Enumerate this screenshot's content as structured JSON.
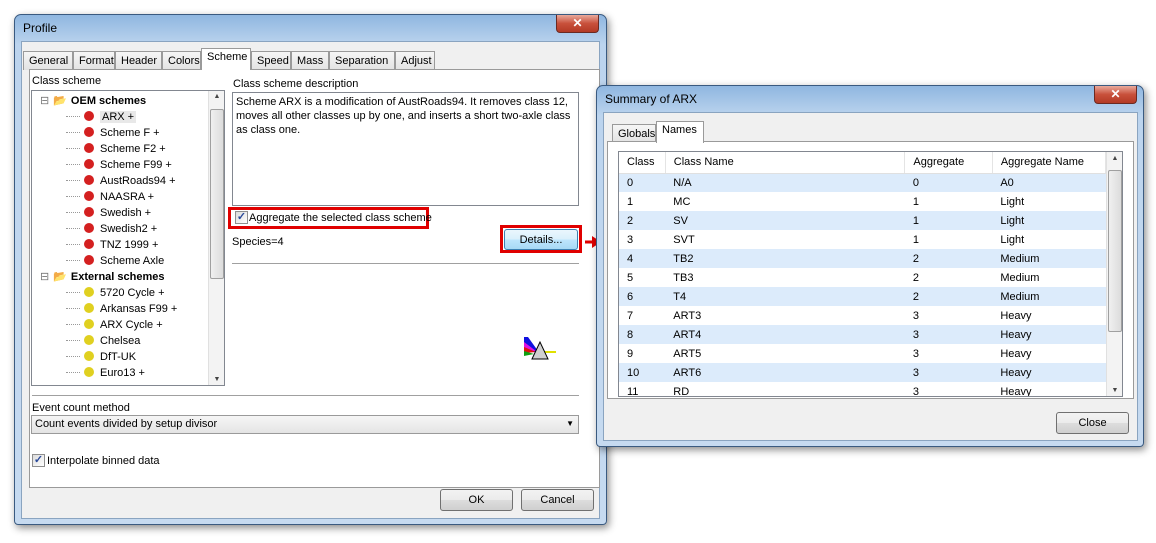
{
  "profile": {
    "title": "Profile",
    "tabs": [
      "General",
      "Format",
      "Header",
      "Colors",
      "Scheme",
      "Speed",
      "Mass",
      "Separation",
      "Adjust"
    ],
    "active_tab": "Scheme",
    "class_scheme_label": "Class scheme",
    "tree": [
      {
        "label": "OEM schemes",
        "group": true
      },
      {
        "label": "ARX +",
        "type": "oem",
        "selected": true
      },
      {
        "label": "Scheme F +",
        "type": "oem"
      },
      {
        "label": "Scheme F2 +",
        "type": "oem"
      },
      {
        "label": "Scheme F99 +",
        "type": "oem"
      },
      {
        "label": "AustRoads94 +",
        "type": "oem"
      },
      {
        "label": "NAASRA +",
        "type": "oem"
      },
      {
        "label": "Swedish +",
        "type": "oem"
      },
      {
        "label": "Swedish2 +",
        "type": "oem"
      },
      {
        "label": "TNZ 1999 +",
        "type": "oem"
      },
      {
        "label": "Scheme Axle",
        "type": "oem"
      },
      {
        "label": "External schemes",
        "group": true
      },
      {
        "label": "5720 Cycle +",
        "type": "external"
      },
      {
        "label": "Arkansas F99 +",
        "type": "external"
      },
      {
        "label": "ARX Cycle +",
        "type": "external"
      },
      {
        "label": "Chelsea",
        "type": "external"
      },
      {
        "label": "DfT-UK",
        "type": "external"
      },
      {
        "label": "Euro13 +",
        "type": "external"
      }
    ],
    "description_label": "Class scheme description",
    "description": "Scheme ARX is a modification of AustRoads94. It removes class 12, moves all other classes up by one, and inserts a short two-axle class as class one.",
    "aggregate_label": "Aggregate the selected class scheme",
    "aggregate_checked": true,
    "species": "Species=4",
    "details_label": "Details...",
    "event_count_label": "Event count method",
    "event_count_value": "Count events divided by setup divisor",
    "interpolate_label": "Interpolate binned data",
    "interpolate_checked": true,
    "ok_label": "OK",
    "cancel_label": "Cancel",
    "prism_icon": "prism-icon"
  },
  "summary": {
    "title": "Summary of ARX",
    "tabs": [
      "Globals",
      "Names"
    ],
    "active_tab": "Names",
    "columns": [
      "Class",
      "Class Name",
      "Aggregate",
      "Aggregate Name"
    ],
    "rows": [
      [
        "0",
        "N/A",
        "0",
        "A0"
      ],
      [
        "1",
        "MC",
        "1",
        "Light"
      ],
      [
        "2",
        "SV",
        "1",
        "Light"
      ],
      [
        "3",
        "SVT",
        "1",
        "Light"
      ],
      [
        "4",
        "TB2",
        "2",
        "Medium"
      ],
      [
        "5",
        "TB3",
        "2",
        "Medium"
      ],
      [
        "6",
        "T4",
        "2",
        "Medium"
      ],
      [
        "7",
        "ART3",
        "3",
        "Heavy"
      ],
      [
        "8",
        "ART4",
        "3",
        "Heavy"
      ],
      [
        "9",
        "ART5",
        "3",
        "Heavy"
      ],
      [
        "10",
        "ART6",
        "3",
        "Heavy"
      ],
      [
        "11",
        "RD",
        "3",
        "Heavy"
      ]
    ],
    "close_label": "Close"
  },
  "colors": {
    "highlight": "#e00000",
    "row_alt": "#dcebfb",
    "oem_icon": "#d42020",
    "external_icon": "#e0d020"
  }
}
